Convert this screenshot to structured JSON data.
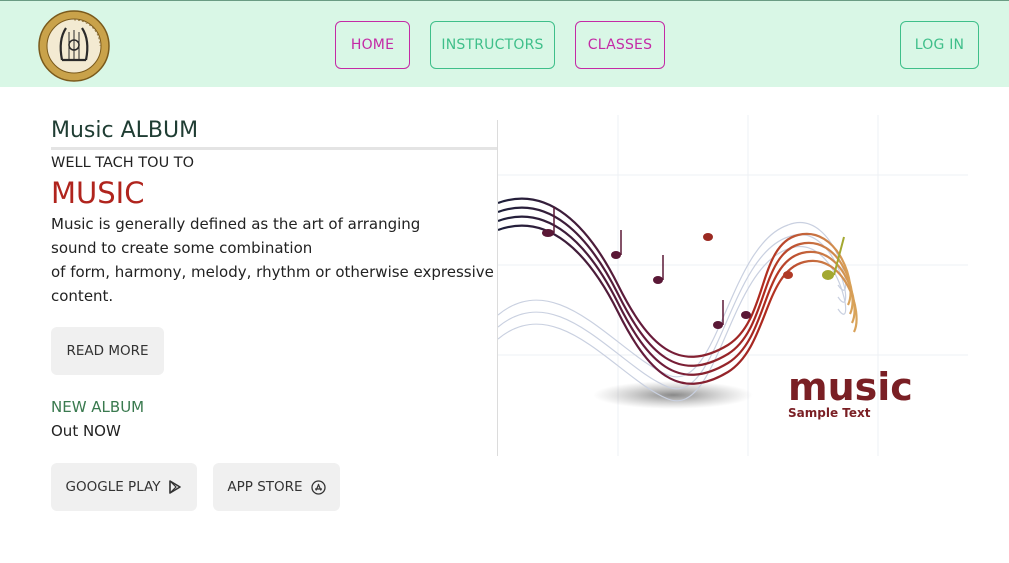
{
  "navbar": {
    "logo_alt": "All Steinway School",
    "items": [
      {
        "label": "HOME"
      },
      {
        "label": "INSTRUCTORS"
      },
      {
        "label": "CLASSES"
      }
    ],
    "login_label": "LOG IN"
  },
  "content": {
    "section_title": "Music ALBUM",
    "subtitle": "WELL TACH TOU TO",
    "headline": "MUSIC",
    "body_lines": [
      "Music is generally defined as the art of arranging",
      "sound to create some combination",
      "of form, harmony, melody, rhythm or otherwise expressive",
      "content."
    ],
    "read_more_label": "READ MORE",
    "album_label": "NEW ALBUM",
    "album_sub": "Out NOW",
    "google_play_label": "GOOGLE PLAY",
    "app_store_label": "APP STORE"
  },
  "hero": {
    "title": "music",
    "subtitle": "Sample Text"
  },
  "colors": {
    "navbar_bg": "#d9f7e6",
    "nav_pink": "#c42aa6",
    "nav_green": "#3fbf8a",
    "headline_red": "#b0241d",
    "album_green": "#3a7a4f"
  },
  "icons": [
    "music-school-logo-icon",
    "play-store-icon",
    "app-store-icon"
  ]
}
